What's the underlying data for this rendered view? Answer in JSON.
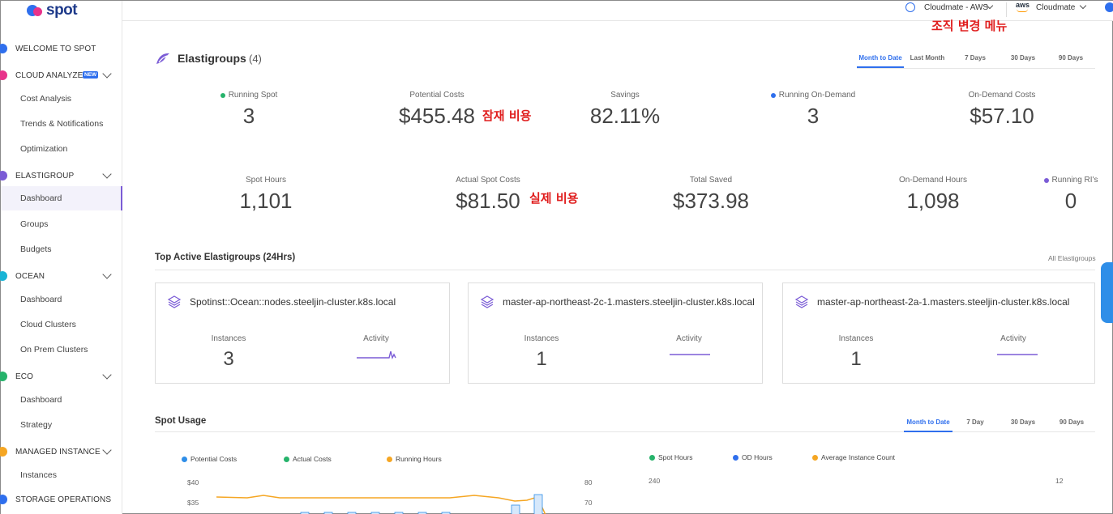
{
  "brand": {
    "logo_text": "spot"
  },
  "sidebar": {
    "sections": [
      {
        "label": "WELCOME TO SPOT",
        "color": "#2f6fed",
        "icon": "welcome-icon"
      },
      {
        "label": "CLOUD ANALYZER",
        "badge": "NEW",
        "color": "#e8338b",
        "icon": "cloud-analyzer-icon",
        "items": [
          "Cost Analysis",
          "Trends & Notifications",
          "Optimization"
        ]
      },
      {
        "label": "ELASTIGROUP",
        "color": "#7b5cd6",
        "icon": "elastigroup-icon",
        "items": [
          "Dashboard",
          "Groups",
          "Budgets"
        ],
        "active_item": "Dashboard"
      },
      {
        "label": "OCEAN",
        "color": "#19b4d6",
        "icon": "ocean-icon",
        "items": [
          "Dashboard",
          "Cloud Clusters",
          "On Prem Clusters"
        ]
      },
      {
        "label": "ECO",
        "color": "#26b36b",
        "icon": "eco-icon",
        "items": [
          "Dashboard",
          "Strategy"
        ]
      },
      {
        "label": "MANAGED INSTANCE",
        "color": "#f5a623",
        "icon": "managed-instance-icon",
        "items": [
          "Instances"
        ]
      },
      {
        "label": "STORAGE OPERATIONS",
        "color": "#2f6fed",
        "icon": "storage-icon"
      }
    ]
  },
  "topbar": {
    "org_selector": "Cloudmate - AWS",
    "account_provider": "aws",
    "account_selector": "Cloudmate"
  },
  "annotations": {
    "org_menu": "조직 변경 메뉴",
    "potential_cost": "잠재 비용",
    "actual_cost": "실제 비용"
  },
  "elastigroups": {
    "title": "Elastigroups",
    "count": "(4)",
    "tabs": [
      "Month to Date",
      "Last Month",
      "7 Days",
      "30 Days",
      "90 Days"
    ],
    "active_tab": "Month to Date",
    "stats_row1": [
      {
        "label": "Running Spot",
        "value": "3",
        "dot": "#26b36b"
      },
      {
        "label": "Potential Costs",
        "value": "$455.48"
      },
      {
        "label": "Savings",
        "value": "82.11%"
      },
      {
        "label": "Running On-Demand",
        "value": "3",
        "dot": "#2f6fed"
      },
      {
        "label": "On-Demand Costs",
        "value": "$57.10"
      }
    ],
    "stats_row2": [
      {
        "label": "Spot Hours",
        "value": "1,101"
      },
      {
        "label": "Actual Spot Costs",
        "value": "$81.50"
      },
      {
        "label": "Total Saved",
        "value": "$373.98"
      },
      {
        "label": "On-Demand Hours",
        "value": "1,098"
      },
      {
        "label": "Running RI's",
        "value": "0",
        "dot": "#7b5cd6"
      }
    ]
  },
  "top_active": {
    "title": "Top Active Elastigroups (24Hrs)",
    "link": "All Elastigroups",
    "instances_label": "Instances",
    "activity_label": "Activity",
    "cards": [
      {
        "name": "Spotinst::Ocean::nodes.steeljin-cluster.k8s.local",
        "instances": "3"
      },
      {
        "name": "master-ap-northeast-2c-1.masters.steeljin-cluster.k8s.local",
        "instances": "1"
      },
      {
        "name": "master-ap-northeast-2a-1.masters.steeljin-cluster.k8s.local",
        "instances": "1"
      }
    ]
  },
  "spot_usage": {
    "title": "Spot Usage",
    "tabs": [
      "Month to Date",
      "7 Day",
      "30 Days",
      "90 Days"
    ],
    "active_tab": "Month to Date",
    "left_legend": [
      {
        "label": "Potential Costs",
        "color": "#2f8ee8"
      },
      {
        "label": "Actual Costs",
        "color": "#26b36b"
      },
      {
        "label": "Running Hours",
        "color": "#f5a623"
      }
    ],
    "right_legend": [
      {
        "label": "Spot Hours",
        "color": "#26b36b"
      },
      {
        "label": "OD Hours",
        "color": "#2f6fed"
      },
      {
        "label": "Average Instance Count",
        "color": "#f5a623"
      }
    ],
    "left_axis_ticks": [
      "$40",
      "$35"
    ],
    "left_axis_right_ticks": [
      "80",
      "70"
    ],
    "right_axis_left_ticks": [
      "240"
    ],
    "right_axis_right_ticks": [
      "12"
    ]
  }
}
